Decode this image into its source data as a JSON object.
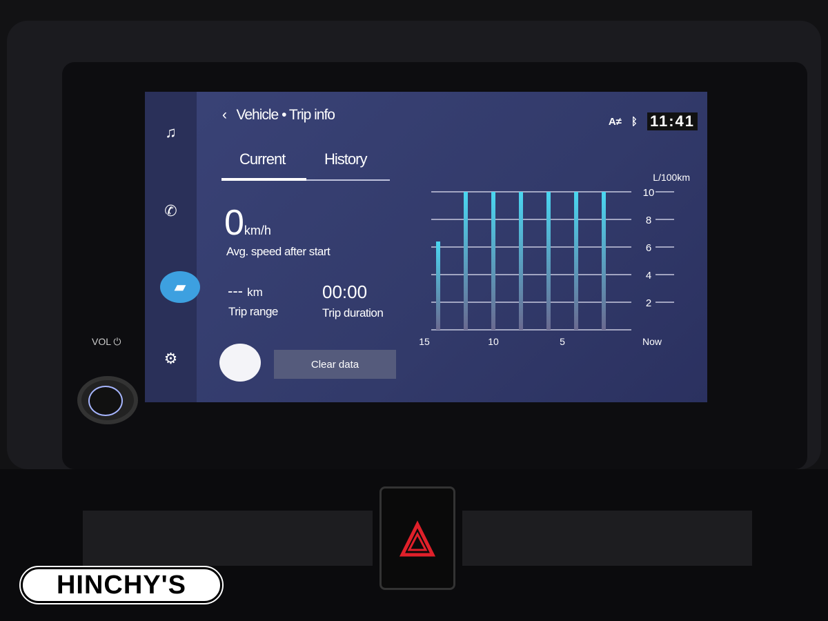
{
  "header": {
    "back_icon": "chevron-left-icon",
    "crumb_parent": "Vehicle",
    "separator": "•",
    "crumb_current": "Trip info",
    "status_icons": [
      "az-icon",
      "bluetooth-icon"
    ],
    "az_label": "A≠",
    "clock": "11:41"
  },
  "sidebar": {
    "items": [
      {
        "icon": "music-icon",
        "glyph": "♫"
      },
      {
        "icon": "phone-icon",
        "glyph": "✆"
      },
      {
        "icon": "car-icon",
        "glyph": "🚘",
        "active": true
      },
      {
        "icon": "gear-icon",
        "glyph": "⚙"
      }
    ]
  },
  "tabs": [
    {
      "label": "Current",
      "active": true
    },
    {
      "label": "History",
      "active": false
    }
  ],
  "stats": {
    "avg_speed_value": "0",
    "avg_speed_unit": "km/h",
    "avg_speed_label": "Avg. speed after start",
    "trip_range_value": "---",
    "trip_range_unit": "km",
    "trip_range_label": "Trip range",
    "trip_duration_value": "00:00",
    "trip_duration_label": "Trip duration"
  },
  "buttons": {
    "clear_data": "Clear data"
  },
  "hardware": {
    "vol_label": "VOL"
  },
  "logo_text": "HINCHY'S",
  "chart_data": {
    "type": "bar",
    "ylabel": "L/100km",
    "ylim": [
      0,
      10
    ],
    "yticks": [
      "2",
      "4",
      "6",
      "8",
      "10"
    ],
    "xticks": [
      "15",
      "10",
      "5",
      "Now"
    ],
    "x": [
      14,
      12,
      10,
      8,
      6,
      4,
      2
    ],
    "values": [
      6.4,
      10,
      10,
      10,
      10,
      10,
      10
    ],
    "grid": true,
    "colors": {
      "bar_top": "#4ad6f0",
      "bar_bottom": "#6a6a90"
    }
  }
}
